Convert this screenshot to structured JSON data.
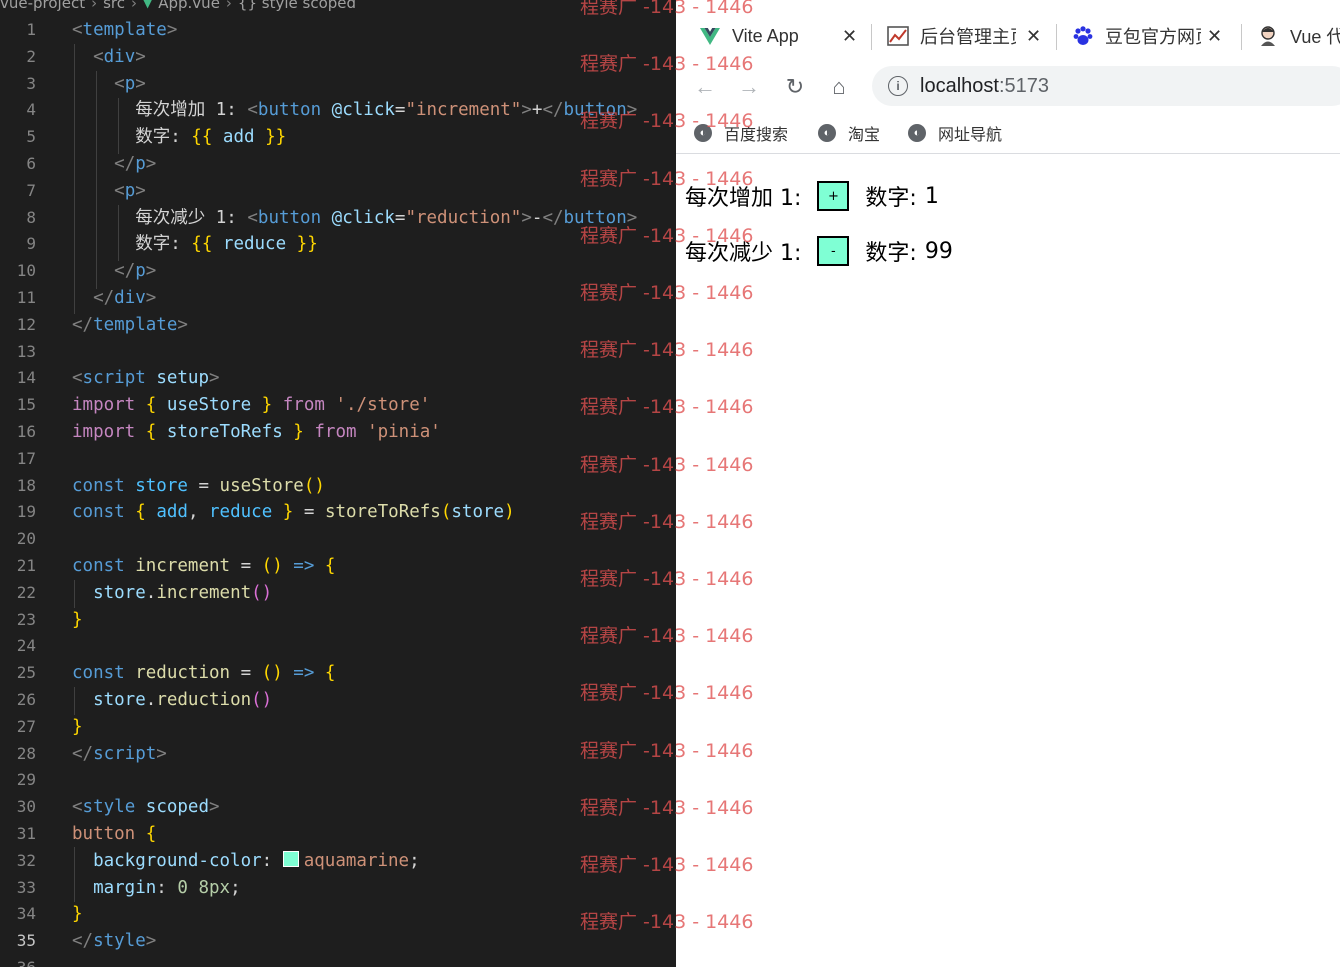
{
  "editor": {
    "breadcrumb": [
      "vue-project",
      "src",
      "App.vue",
      "{} style scoped"
    ],
    "lines": [
      {
        "n": "1",
        "t": [
          [
            "tok-br",
            "<"
          ],
          [
            "tok-tag",
            "template"
          ],
          [
            "tok-br",
            ">"
          ]
        ]
      },
      {
        "n": "2",
        "t": [
          [
            "tok-txt",
            "  "
          ],
          [
            "tok-br",
            "<"
          ],
          [
            "tok-tag",
            "div"
          ],
          [
            "tok-br",
            ">"
          ]
        ]
      },
      {
        "n": "3",
        "t": [
          [
            "tok-txt",
            "    "
          ],
          [
            "tok-br",
            "<"
          ],
          [
            "tok-tag",
            "p"
          ],
          [
            "tok-br",
            ">"
          ]
        ]
      },
      {
        "n": "4",
        "t": [
          [
            "tok-txt",
            "      每次增加 1: "
          ],
          [
            "tok-br",
            "<"
          ],
          [
            "tok-tag",
            "button"
          ],
          [
            "tok-txt",
            " "
          ],
          [
            "tok-attr",
            "@click"
          ],
          [
            "tok-txt",
            "="
          ],
          [
            "tok-str",
            "\"increment\""
          ],
          [
            "tok-br",
            ">"
          ],
          [
            "tok-txt",
            "+"
          ],
          [
            "tok-br",
            "</"
          ],
          [
            "tok-tag",
            "button"
          ],
          [
            "tok-br",
            ">"
          ]
        ]
      },
      {
        "n": "5",
        "t": [
          [
            "tok-txt",
            "      数字: "
          ],
          [
            "tok-cy",
            "{{"
          ],
          [
            "tok-prop",
            " add "
          ],
          [
            "tok-cy",
            "}}"
          ]
        ]
      },
      {
        "n": "6",
        "t": [
          [
            "tok-txt",
            "    "
          ],
          [
            "tok-br",
            "</"
          ],
          [
            "tok-tag",
            "p"
          ],
          [
            "tok-br",
            ">"
          ]
        ]
      },
      {
        "n": "7",
        "t": [
          [
            "tok-txt",
            "    "
          ],
          [
            "tok-br",
            "<"
          ],
          [
            "tok-tag",
            "p"
          ],
          [
            "tok-br",
            ">"
          ]
        ]
      },
      {
        "n": "8",
        "t": [
          [
            "tok-txt",
            "      每次减少 1: "
          ],
          [
            "tok-br",
            "<"
          ],
          [
            "tok-tag",
            "button"
          ],
          [
            "tok-txt",
            " "
          ],
          [
            "tok-attr",
            "@click"
          ],
          [
            "tok-txt",
            "="
          ],
          [
            "tok-str",
            "\"reduction\""
          ],
          [
            "tok-br",
            ">"
          ],
          [
            "tok-txt",
            "-"
          ],
          [
            "tok-br",
            "</"
          ],
          [
            "tok-tag",
            "button"
          ],
          [
            "tok-br",
            ">"
          ]
        ]
      },
      {
        "n": "9",
        "t": [
          [
            "tok-txt",
            "      数字: "
          ],
          [
            "tok-cy",
            "{{"
          ],
          [
            "tok-prop",
            " reduce "
          ],
          [
            "tok-cy",
            "}}"
          ]
        ]
      },
      {
        "n": "10",
        "t": [
          [
            "tok-txt",
            "    "
          ],
          [
            "tok-br",
            "</"
          ],
          [
            "tok-tag",
            "p"
          ],
          [
            "tok-br",
            ">"
          ]
        ]
      },
      {
        "n": "11",
        "t": [
          [
            "tok-txt",
            "  "
          ],
          [
            "tok-br",
            "</"
          ],
          [
            "tok-tag",
            "div"
          ],
          [
            "tok-br",
            ">"
          ]
        ]
      },
      {
        "n": "12",
        "t": [
          [
            "tok-br",
            "</"
          ],
          [
            "tok-tag",
            "template"
          ],
          [
            "tok-br",
            ">"
          ]
        ]
      },
      {
        "n": "13",
        "t": []
      },
      {
        "n": "14",
        "t": [
          [
            "tok-br",
            "<"
          ],
          [
            "tok-tag",
            "script"
          ],
          [
            "tok-txt",
            " "
          ],
          [
            "tok-attr",
            "setup"
          ],
          [
            "tok-br",
            ">"
          ]
        ]
      },
      {
        "n": "15",
        "t": [
          [
            "tok-kwc",
            "import"
          ],
          [
            "tok-txt",
            " "
          ],
          [
            "tok-cy",
            "{"
          ],
          [
            "tok-prop",
            " useStore "
          ],
          [
            "tok-cy",
            "}"
          ],
          [
            "tok-txt",
            " "
          ],
          [
            "tok-kwc",
            "from"
          ],
          [
            "tok-txt",
            " "
          ],
          [
            "tok-str",
            "'./store'"
          ]
        ]
      },
      {
        "n": "16",
        "t": [
          [
            "tok-kwc",
            "import"
          ],
          [
            "tok-txt",
            " "
          ],
          [
            "tok-cy",
            "{"
          ],
          [
            "tok-prop",
            " storeToRefs "
          ],
          [
            "tok-cy",
            "}"
          ],
          [
            "tok-txt",
            " "
          ],
          [
            "tok-kwc",
            "from"
          ],
          [
            "tok-txt",
            " "
          ],
          [
            "tok-str",
            "'pinia'"
          ]
        ]
      },
      {
        "n": "17",
        "t": []
      },
      {
        "n": "18",
        "t": [
          [
            "tok-kw",
            "const"
          ],
          [
            "tok-txt",
            " "
          ],
          [
            "tok-var",
            "store"
          ],
          [
            "tok-txt",
            " = "
          ],
          [
            "tok-fn",
            "useStore"
          ],
          [
            "tok-cy",
            "()"
          ]
        ]
      },
      {
        "n": "19",
        "t": [
          [
            "tok-kw",
            "const"
          ],
          [
            "tok-txt",
            " "
          ],
          [
            "tok-cy",
            "{"
          ],
          [
            "tok-txt",
            " "
          ],
          [
            "tok-var",
            "add"
          ],
          [
            "tok-txt",
            ", "
          ],
          [
            "tok-var",
            "reduce"
          ],
          [
            "tok-txt",
            " "
          ],
          [
            "tok-cy",
            "}"
          ],
          [
            "tok-txt",
            " = "
          ],
          [
            "tok-fn",
            "storeToRefs"
          ],
          [
            "tok-cy",
            "("
          ],
          [
            "tok-prop",
            "store"
          ],
          [
            "tok-cy",
            ")"
          ]
        ]
      },
      {
        "n": "20",
        "t": []
      },
      {
        "n": "21",
        "t": [
          [
            "tok-kw",
            "const"
          ],
          [
            "tok-txt",
            " "
          ],
          [
            "tok-fn",
            "increment"
          ],
          [
            "tok-txt",
            " = "
          ],
          [
            "tok-cy",
            "()"
          ],
          [
            "tok-txt",
            " "
          ],
          [
            "tok-kw",
            "=>"
          ],
          [
            "tok-txt",
            " "
          ],
          [
            "tok-cy",
            "{"
          ]
        ]
      },
      {
        "n": "22",
        "t": [
          [
            "tok-txt",
            "  "
          ],
          [
            "tok-prop",
            "store"
          ],
          [
            "tok-txt",
            "."
          ],
          [
            "tok-fn",
            "increment"
          ],
          [
            "tok-cp",
            "()"
          ]
        ]
      },
      {
        "n": "23",
        "t": [
          [
            "tok-cy",
            "}"
          ]
        ]
      },
      {
        "n": "24",
        "t": []
      },
      {
        "n": "25",
        "t": [
          [
            "tok-kw",
            "const"
          ],
          [
            "tok-txt",
            " "
          ],
          [
            "tok-fn",
            "reduction"
          ],
          [
            "tok-txt",
            " = "
          ],
          [
            "tok-cy",
            "()"
          ],
          [
            "tok-txt",
            " "
          ],
          [
            "tok-kw",
            "=>"
          ],
          [
            "tok-txt",
            " "
          ],
          [
            "tok-cy",
            "{"
          ]
        ]
      },
      {
        "n": "26",
        "t": [
          [
            "tok-txt",
            "  "
          ],
          [
            "tok-prop",
            "store"
          ],
          [
            "tok-txt",
            "."
          ],
          [
            "tok-fn",
            "reduction"
          ],
          [
            "tok-cp",
            "()"
          ]
        ]
      },
      {
        "n": "27",
        "t": [
          [
            "tok-cy",
            "}"
          ]
        ]
      },
      {
        "n": "28",
        "t": [
          [
            "tok-br",
            "</"
          ],
          [
            "tok-tag",
            "script"
          ],
          [
            "tok-br",
            ">"
          ]
        ]
      },
      {
        "n": "29",
        "t": []
      },
      {
        "n": "30",
        "t": [
          [
            "tok-br",
            "<"
          ],
          [
            "tok-tag",
            "style"
          ],
          [
            "tok-txt",
            " "
          ],
          [
            "tok-attr",
            "scoped"
          ],
          [
            "tok-br",
            ">"
          ]
        ]
      },
      {
        "n": "31",
        "t": [
          [
            "tok-str",
            "button"
          ],
          [
            "tok-txt",
            " "
          ],
          [
            "tok-cy",
            "{"
          ]
        ]
      },
      {
        "n": "32",
        "t": [
          [
            "tok-txt",
            "  "
          ],
          [
            "tok-prop",
            "background-color"
          ],
          [
            "tok-txt",
            ": "
          ],
          [
            "swatch",
            ""
          ],
          [
            "tok-str",
            "aquamarine"
          ],
          [
            "tok-txt",
            ";"
          ]
        ]
      },
      {
        "n": "33",
        "t": [
          [
            "tok-txt",
            "  "
          ],
          [
            "tok-prop",
            "margin"
          ],
          [
            "tok-txt",
            ": "
          ],
          [
            "tok-num",
            "0 8px"
          ],
          [
            "tok-txt",
            ";"
          ]
        ]
      },
      {
        "n": "34",
        "t": [
          [
            "tok-cy",
            "}"
          ]
        ]
      },
      {
        "n": "35",
        "t": [
          [
            "tok-br",
            "</"
          ],
          [
            "tok-tag",
            "style"
          ],
          [
            "tok-br",
            ">"
          ]
        ]
      },
      {
        "n": "36",
        "t": []
      }
    ],
    "active_line": "35"
  },
  "browser": {
    "tabs": [
      {
        "title": "Vite App",
        "icon": "vite-logo-icon"
      },
      {
        "title": "后台管理主页",
        "icon": "admin-panel-icon"
      },
      {
        "title": "豆包官方网页",
        "icon": "baidu-paw-icon"
      },
      {
        "title": "Vue 代",
        "icon": "avatar-icon"
      }
    ],
    "url_host": "localhost",
    "url_port": ":5173",
    "bookmarks": [
      "百度搜索",
      "淘宝",
      "网址导航"
    ],
    "page": {
      "row1": {
        "label": "每次增加 1:",
        "button": "+",
        "value_label": "数字:",
        "value": "1"
      },
      "row2": {
        "label": "每次减少 1:",
        "button": "-",
        "value_label": "数字:",
        "value": "99"
      }
    }
  },
  "watermark": "程赛广 -143 - 1446",
  "colors": {
    "editor_bg": "#1e1e1e",
    "button_bg": "#7fffd4",
    "watermark": "#e05050"
  }
}
